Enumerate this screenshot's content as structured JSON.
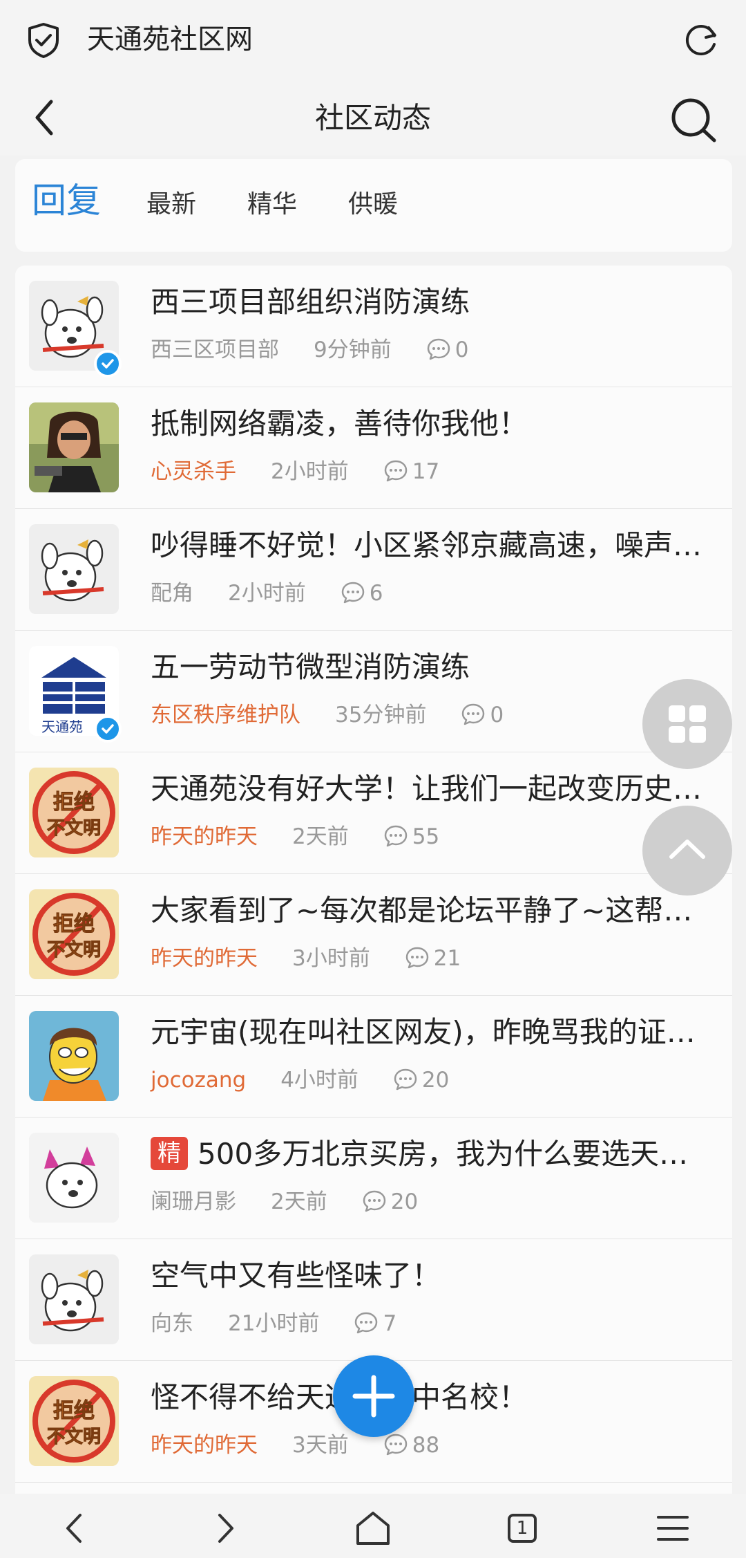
{
  "browser": {
    "site_title": "天通苑社区网"
  },
  "header": {
    "title": "社区动态"
  },
  "tabs": [
    {
      "label": "回复",
      "active": true
    },
    {
      "label": "最新",
      "active": false
    },
    {
      "label": "精华",
      "active": false
    },
    {
      "label": "供暖",
      "active": false
    }
  ],
  "posts": [
    {
      "title": "西三项目部组织消防演练",
      "author": "西三区项目部",
      "author_highlight": false,
      "time": "9分钟前",
      "replies": "0",
      "avatar": "dog-icon",
      "verified": true
    },
    {
      "title": "抵制网络霸凌，善待你我他！",
      "author": "心灵杀手",
      "author_highlight": true,
      "time": "2小时前",
      "replies": "17",
      "avatar": "gunman-icon",
      "verified": false
    },
    {
      "title": "吵得睡不好觉！小区紧邻京藏高速，噪声…",
      "author": "配角",
      "author_highlight": false,
      "time": "2小时前",
      "replies": "6",
      "avatar": "dog-icon",
      "verified": false
    },
    {
      "title": "五一劳动节微型消防演练",
      "author": "东区秩序维护队",
      "author_highlight": true,
      "time": "35分钟前",
      "replies": "0",
      "avatar": "building-logo-icon",
      "verified": true
    },
    {
      "title": "天通苑没有好大学！让我们一起改变历史…",
      "author": "昨天的昨天",
      "author_highlight": true,
      "time": "2天前",
      "replies": "55",
      "avatar": "no-incivility-icon",
      "verified": false
    },
    {
      "title": "大家看到了~每次都是论坛平静了~这帮…",
      "author": "昨天的昨天",
      "author_highlight": true,
      "time": "3小时前",
      "replies": "21",
      "avatar": "no-incivility-icon",
      "verified": false
    },
    {
      "title": "元宇宙(现在叫社区网友)，昨晚骂我的证…",
      "author": "jocozang",
      "author_highlight": true,
      "time": "4小时前",
      "replies": "20",
      "avatar": "cartoon-man-icon",
      "verified": false
    },
    {
      "title": "500多万北京买房，我为什么要选天…",
      "badge": "精",
      "author": "阑珊月影",
      "author_highlight": false,
      "time": "2天前",
      "replies": "20",
      "avatar": "pink-dog-icon",
      "verified": false
    },
    {
      "title": "空气中又有些怪味了！",
      "author": "向东",
      "author_highlight": false,
      "time": "21小时前",
      "replies": "7",
      "avatar": "dog-icon",
      "verified": false
    },
    {
      "title": "怪不得不给天通苑高中名校！",
      "author": "昨天的昨天",
      "author_highlight": true,
      "time": "3天前",
      "replies": "88",
      "avatar": "no-incivility-icon",
      "verified": false
    }
  ],
  "avatar_text": {
    "sign_top": "拒绝",
    "sign_bottom": "不文明",
    "logo": "天通苑"
  },
  "bottom_nav": {
    "tab_count": "1"
  },
  "colors": {
    "accent": "#2b84d6",
    "author_orange": "#e06a36",
    "fab_blue": "#1e88e5",
    "badge_red": "#e5483a"
  }
}
